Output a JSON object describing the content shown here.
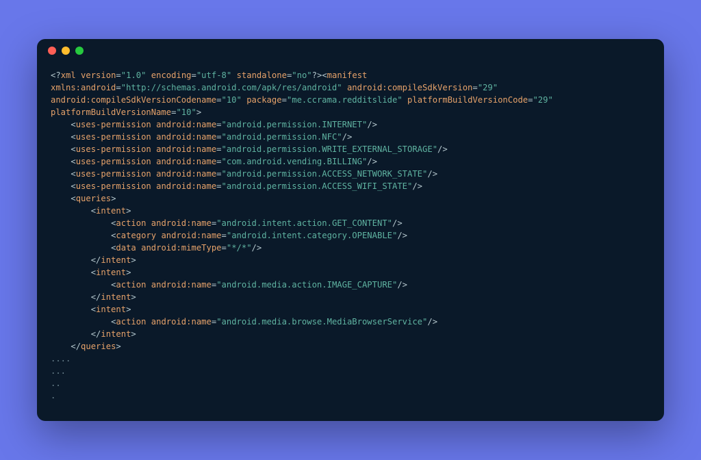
{
  "window": {
    "dots": [
      "red",
      "yellow",
      "green"
    ]
  },
  "xml": {
    "prolog": {
      "version": "1.0",
      "encoding": "utf-8",
      "standalone": "no"
    },
    "manifest": {
      "xmlns_android": "http://schemas.android.com/apk/res/android",
      "compileSdkVersion": "29",
      "compileSdkVersionCodename": "10",
      "package": "me.ccrama.redditslide",
      "platformBuildVersionCode": "29",
      "platformBuildVersionName": "10"
    },
    "permissions": [
      "android.permission.INTERNET",
      "android.permission.NFC",
      "android.permission.WRITE_EXTERNAL_STORAGE",
      "com.android.vending.BILLING",
      "android.permission.ACCESS_NETWORK_STATE",
      "android.permission.ACCESS_WIFI_STATE"
    ],
    "queries": [
      {
        "action": "android.intent.action.GET_CONTENT",
        "category": "android.intent.category.OPENABLE",
        "data_mime": "*/*"
      },
      {
        "action": "android.media.action.IMAGE_CAPTURE"
      },
      {
        "action": "android.media.browse.MediaBrowserService"
      }
    ],
    "trailing": [
      "....",
      "...",
      "..",
      "."
    ]
  }
}
